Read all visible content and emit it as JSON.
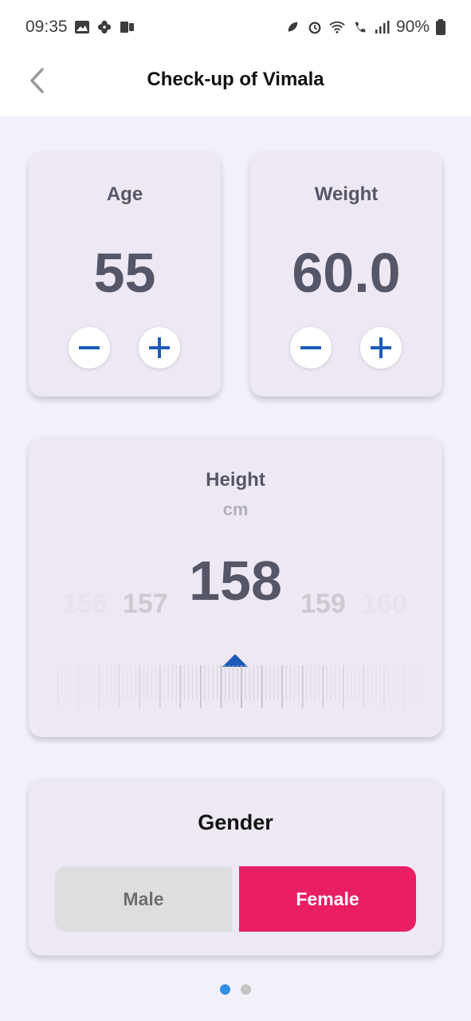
{
  "status_bar": {
    "time": "09:35",
    "battery": "90%"
  },
  "header": {
    "title": "Check-up of Vimala"
  },
  "age": {
    "label": "Age",
    "value": "55"
  },
  "weight": {
    "label": "Weight",
    "value": "60.0"
  },
  "height": {
    "label": "Height",
    "unit": "cm",
    "value": "158",
    "neighbors": [
      "156",
      "157",
      "159",
      "160"
    ]
  },
  "gender": {
    "label": "Gender",
    "options": [
      "Male",
      "Female"
    ],
    "selected": "Female"
  },
  "pager": {
    "count": 2,
    "active": 0
  },
  "colors": {
    "accent_blue": "#1e5bb8",
    "female_pink": "#e91e63",
    "card_bg": "#ede8f3",
    "page_bg": "#f2f1f9"
  }
}
